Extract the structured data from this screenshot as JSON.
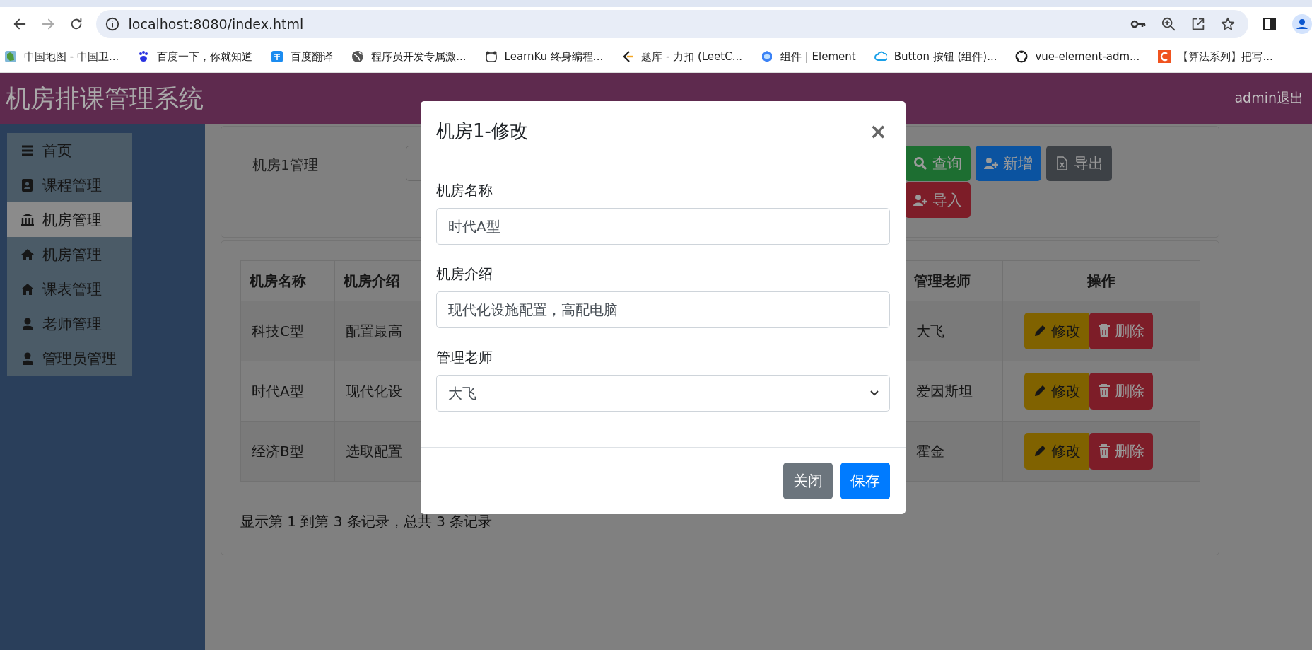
{
  "browser": {
    "address": "localhost:8080/index.html",
    "bookmarks": [
      "中国地图 - 中国卫...",
      "百度一下，你就知道",
      "百度翻译",
      "程序员开发专属激...",
      "LearnKu 终身编程...",
      "题库 - 力扣 (LeetC...",
      "组件 | Element",
      "Button 按钮 (组件)...",
      "vue-element-adm...",
      "【算法系列】把写..."
    ]
  },
  "header": {
    "title": "机房排课管理系统",
    "user_link": "admin退出"
  },
  "sidebar": {
    "items": [
      {
        "label": "首页",
        "selected": false
      },
      {
        "label": "课程管理",
        "selected": false
      },
      {
        "label": "机房管理",
        "selected": true
      },
      {
        "label": "机房管理",
        "selected": false
      },
      {
        "label": "课表管理",
        "selected": false
      },
      {
        "label": "老师管理",
        "selected": false
      },
      {
        "label": "管理员管理",
        "selected": false
      }
    ]
  },
  "toolbar": {
    "label": "机房1管理",
    "buttons": [
      {
        "label": "查询",
        "kind": "success"
      },
      {
        "label": "新增",
        "kind": "primary"
      },
      {
        "label": "导出",
        "kind": "secondary"
      },
      {
        "label": "导入",
        "kind": "danger"
      }
    ]
  },
  "table": {
    "columns": [
      "机房名称",
      "机房介绍",
      "管理老师",
      "操作"
    ],
    "rows": [
      {
        "cells": [
          "科技C型",
          "配置最高",
          "大飞"
        ],
        "actions": [
          "修改",
          "删除"
        ]
      },
      {
        "cells": [
          "时代A型",
          "现代化设",
          "爱因斯坦"
        ],
        "actions": [
          "修改",
          "删除"
        ]
      },
      {
        "cells": [
          "经济B型",
          "选取配置",
          "霍金"
        ],
        "actions": [
          "修改",
          "删除"
        ]
      }
    ]
  },
  "pagination": "显示第 1 到第 3 条记录，总共 3 条记录",
  "modal": {
    "title": "机房1-修改",
    "close": "×",
    "fields": [
      {
        "label": "机房名称",
        "kind": "text",
        "value": "时代A型"
      },
      {
        "label": "机房介绍",
        "kind": "text",
        "value": "现代化设施配置，高配电脑"
      },
      {
        "label": "管理老师",
        "kind": "select",
        "value": "大飞"
      }
    ],
    "buttons": [
      {
        "label": "关闭",
        "kind": "secondary"
      },
      {
        "label": "保存",
        "kind": "primary"
      }
    ]
  }
}
